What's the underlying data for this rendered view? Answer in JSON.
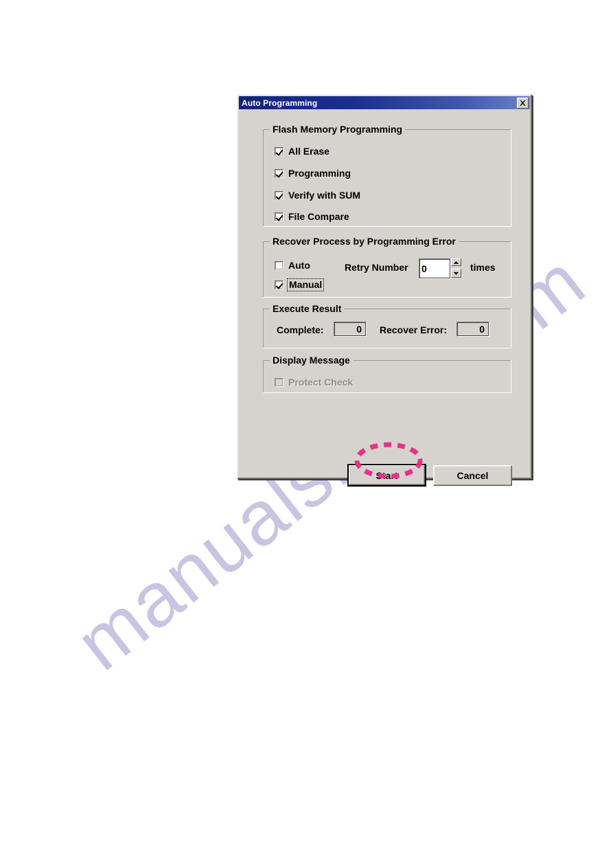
{
  "watermark": {
    "text": "manualshive.com",
    "color": "#b3b0d8"
  },
  "dialog": {
    "title": "Auto Programming",
    "title_bar_color": "#14227a",
    "face_color": "#d6d3ce",
    "close_icon": "close-icon",
    "groups": {
      "flash": {
        "title": "Flash Memory Programming",
        "checkboxes": [
          {
            "label": "All Erase",
            "checked": true,
            "enabled": true
          },
          {
            "label": "Programming",
            "checked": true,
            "enabled": true
          },
          {
            "label": "Verify with SUM",
            "checked": true,
            "enabled": true
          },
          {
            "label": "File Compare",
            "checked": true,
            "enabled": true
          }
        ]
      },
      "recover": {
        "title": "Recover Process by Programming Error",
        "checkboxes": [
          {
            "label": "Auto",
            "checked": false,
            "enabled": true,
            "focused": false
          },
          {
            "label": "Manual",
            "checked": true,
            "enabled": true,
            "focused": true
          }
        ],
        "retry_label": "Retry Number",
        "retry_value": "0",
        "retry_units": "times",
        "spinner_up_icon": "triangle-up-icon",
        "spinner_down_icon": "triangle-down-icon"
      },
      "execute": {
        "title": "Execute Result",
        "complete_label": "Complete:",
        "complete_value": "0",
        "recover_error_label": "Recover Error:",
        "recover_error_value": "0"
      },
      "display": {
        "title": "Display Message",
        "checkboxes": [
          {
            "label": "Protect Check",
            "checked": false,
            "enabled": false
          }
        ]
      }
    },
    "buttons": {
      "start": "Start",
      "cancel": "Cancel"
    }
  },
  "annotation": {
    "shape": "dashed-ellipse",
    "target": "Start",
    "color": "#e8308a"
  }
}
